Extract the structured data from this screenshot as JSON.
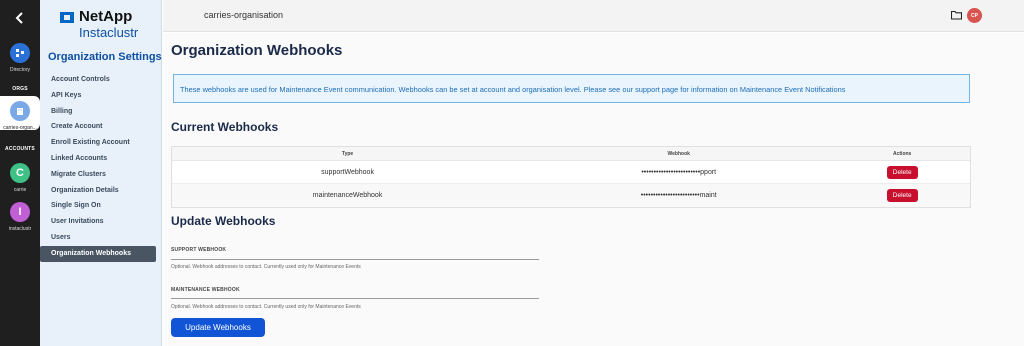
{
  "rail": {
    "items": [
      {
        "label": "Directory",
        "letter": "",
        "color": "#2a72d8"
      },
      {
        "label": "carries-organ...",
        "letter": "",
        "color": "#7aa9e6"
      },
      {
        "label": "carrie",
        "letter": "C",
        "color": "#3ec087"
      },
      {
        "label": "instaclustr",
        "letter": "I",
        "color": "#c05fd6"
      }
    ],
    "section_orgs": "ORGS",
    "section_accounts": "ACCOUNTS"
  },
  "logo": {
    "brand": "NetApp",
    "product": "Instaclustr"
  },
  "sidebar": {
    "title": "Organization Settings",
    "items": [
      "Account Controls",
      "API Keys",
      "Billing",
      "Create Account",
      "Enroll Existing Account",
      "Linked Accounts",
      "Migrate Clusters",
      "Organization Details",
      "Single Sign On",
      "User Invitations",
      "Users",
      "Organization Webhooks"
    ]
  },
  "topbar": {
    "org_name": "carries-organisation",
    "avatar_initials": "CP"
  },
  "main": {
    "title": "Organization Webhooks",
    "info": "These webhooks are used for Maintenance Event communication. Webhooks can be set at account and organisation level. Please see our support page for information on Maintenance Event Notifications",
    "current_title": "Current Webhooks",
    "table": {
      "headers": {
        "type": "Type",
        "webhook": "Webhook",
        "actions": "Actions"
      },
      "rows": [
        {
          "type": "supportWebhook",
          "webhook": "••••••••••••••••••••••••pport",
          "action": "Delete"
        },
        {
          "type": "maintenanceWebhook",
          "webhook": "••••••••••••••••••••••••maint",
          "action": "Delete"
        }
      ]
    },
    "update_title": "Update Webhooks",
    "support_label": "SUPPORT WEBHOOK",
    "support_help": "Optional. Webhook addresses to contact. Currently used only for Maintenance Events",
    "maintenance_label": "MAINTENANCE WEBHOOK",
    "maintenance_help": "Optional. Webhook addresses to contact. Currently used only for Maintenance Events",
    "update_button": "Update Webhooks"
  }
}
